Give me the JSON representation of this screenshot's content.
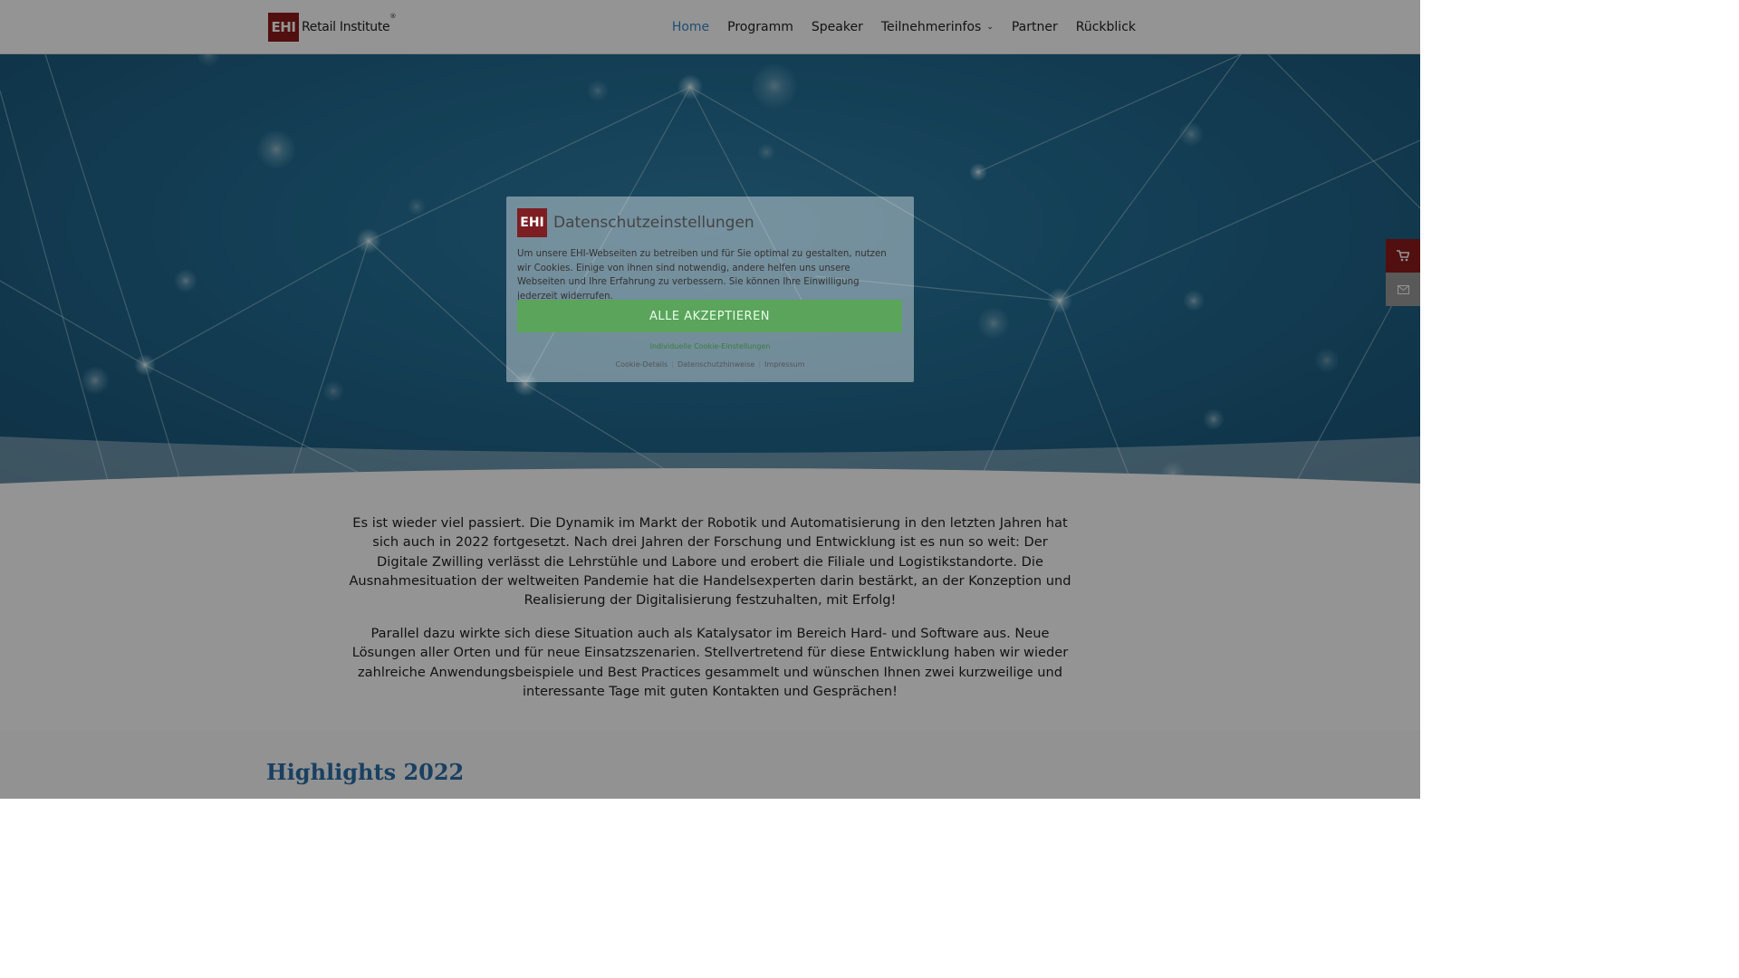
{
  "header": {
    "logo_box": "EHI",
    "logo_text": "Retail Institute",
    "logo_reg": "®",
    "nav": [
      {
        "label": "Home",
        "active": true
      },
      {
        "label": "Programm"
      },
      {
        "label": "Speaker"
      },
      {
        "label": "Teilnehmerinfos",
        "has_dropdown": true
      },
      {
        "label": "Partner"
      },
      {
        "label": "Rückblick"
      }
    ]
  },
  "content": {
    "paragraph_1": "Es ist wieder viel passiert. Die Dynamik im Markt der Robotik und Automatisierung in den letzten Jahren hat sich auch in 2022 fortgesetzt. Nach drei Jahren der Forschung und Entwicklung ist es nun so weit: Der Digitale Zwilling verlässt die Lehrstühle und Labore und erobert die Filiale und Logistikstandorte. Die Ausnahmesituation der weltweiten Pandemie hat die Handelsexperten darin bestärkt, an der Konzeption und Realisierung der Digitalisierung festzuhalten, mit Erfolg!",
    "paragraph_2": "Parallel dazu wirkte sich diese Situation auch als Katalysator im Bereich Hard- und Software aus. Neue Lösungen aller Orten und für neue Einsatzszenarien. Stellvertretend für diese Entwicklung haben wir wieder zahlreiche Anwendungsbeispiele und Best Practices gesammelt und wünschen Ihnen zwei kurzweilige und interessante Tage mit guten Kontakten und Gesprächen!",
    "highlights_title": "Highlights 2022"
  },
  "side_buttons": {
    "cart_icon": "cart-icon",
    "mail_icon": "mail-icon"
  },
  "cookie_modal": {
    "logo": "EHI",
    "title": "Datenschutzeinstellungen",
    "text": "Um unsere EHI-Webseiten zu betreiben und für Sie optimal zu gestalten, nutzen wir Cookies. Einige von ihnen sind notwendig, andere helfen uns unsere Webseiten und Ihre Erfahrung zu verbessern. Sie können Ihre Einwilligung jederzeit widerrufen.",
    "accept_label": "ALLE AKZEPTIEREN",
    "individual_label": "Individuelle Cookie-Einstellungen",
    "links": [
      "Cookie-Details",
      "Datenschutzhinweise",
      "Impressum"
    ],
    "separator": "|"
  },
  "colors": {
    "brand_red": "#8e1b1b",
    "nav_active": "#3a86c4",
    "accept_green": "#5aa45c",
    "hero_blue": "#226c93"
  }
}
